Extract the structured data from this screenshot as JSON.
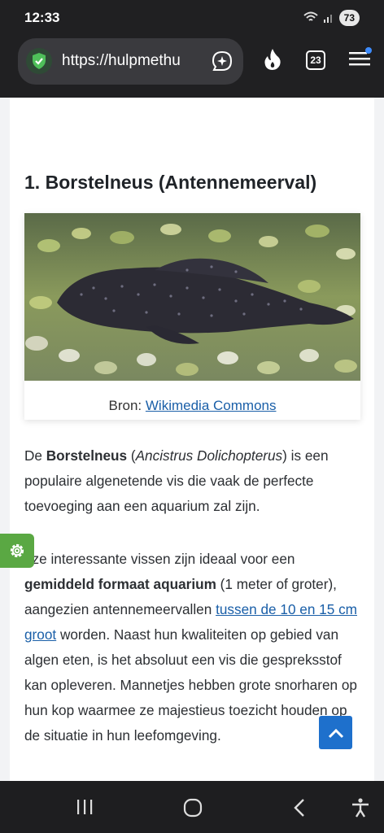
{
  "status": {
    "time": "12:33",
    "battery": "73"
  },
  "browser": {
    "url": "https://hulpmethu",
    "tabs_count": "23",
    "colors": {
      "shield": "#4fbf5a",
      "menu_dot": "#3d8cff"
    }
  },
  "article": {
    "heading_number": "1.",
    "heading_text": "Borstelneus (Antennemeerval)",
    "caption_prefix": "Bron:",
    "caption_link": "Wikimedia Commons",
    "p1": {
      "t1": "De ",
      "b1": "Borstelneus",
      "t2": " (",
      "i1": "Ancistrus Dolichopterus",
      "t3": ") is een populaire algenetende vis die vaak de perfecte toevoeging aan een aquarium zal zijn."
    },
    "p2": {
      "t1": "eze interessante vissen zijn ideaal voor een ",
      "b1": "gemiddeld formaat aquarium",
      "t2": " (1 meter of groter), aangezien antennemeervallen ",
      "link": "tussen de 10 en 15 cm groot",
      "t3": " worden. Naast hun kwaliteiten op gebied van algen eten, is het absoluut een vis die gespreksstof kan opleveren. Mannetjes hebben grote snorharen op hun kop waarmee ze majestieus toezicht houden op de situatie in hun leefomgeving."
    }
  },
  "icons": {
    "shield": "shield-check-icon",
    "share": "share-spark-icon",
    "fire": "fire-icon",
    "tabs": "tabs-icon",
    "menu": "menu-icon",
    "gear": "gear-icon",
    "scroll_top": "chevron-up-icon",
    "nav_recent": "recent-apps-icon",
    "nav_home": "home-icon",
    "nav_back": "back-icon",
    "nav_access": "accessibility-icon"
  }
}
